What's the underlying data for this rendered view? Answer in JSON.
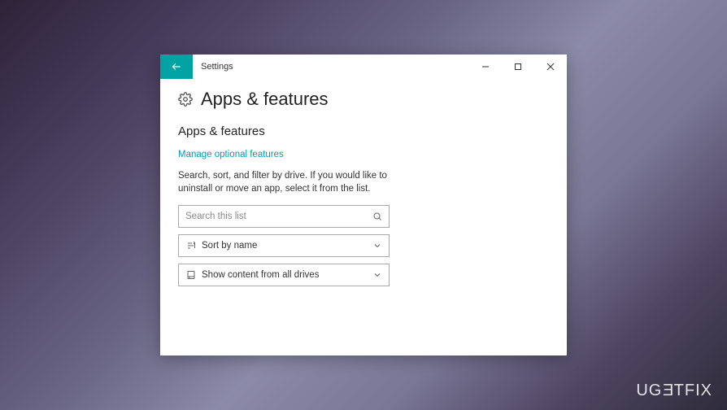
{
  "window": {
    "title": "Settings"
  },
  "page": {
    "title": "Apps & features",
    "section_title": "Apps & features",
    "link_text": "Manage optional features",
    "help_text": "Search, sort, and filter by drive. If you would like to uninstall or move an app, select it from the list."
  },
  "search": {
    "placeholder": "Search this list"
  },
  "sort_dropdown": {
    "label": "Sort by name"
  },
  "filter_dropdown": {
    "label": "Show content from all drives"
  },
  "watermark": {
    "part1": "UG",
    "part2": "E",
    "part3": "TFIX"
  }
}
